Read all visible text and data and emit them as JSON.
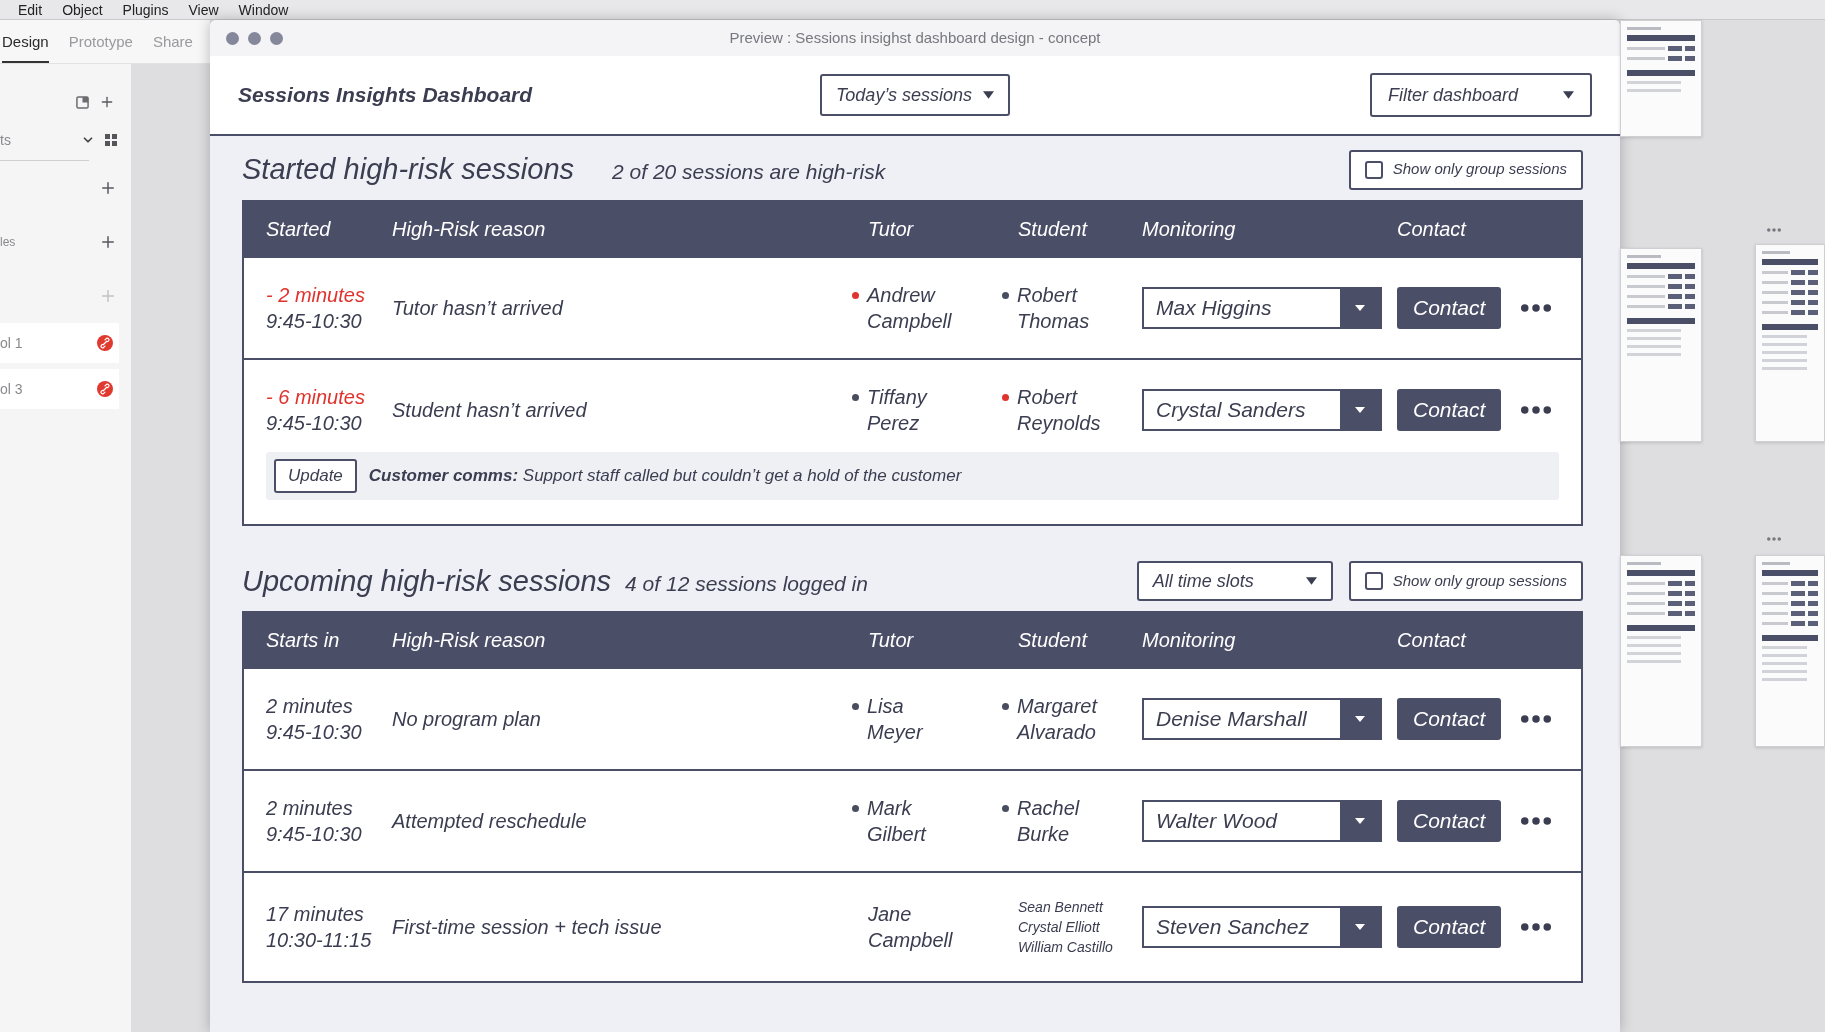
{
  "menu_bar": {
    "items": [
      "Edit",
      "Object",
      "Plugins",
      "View",
      "Window"
    ]
  },
  "side_panel": {
    "tabs": [
      {
        "label": "Design",
        "selected": true
      },
      {
        "label": "Prototype",
        "selected": false
      },
      {
        "label": "Share",
        "selected": false
      }
    ],
    "rows": [
      {
        "kind": "tools"
      },
      {
        "kind": "select",
        "label": "ts"
      },
      {
        "kind": "add",
        "disabled": false
      },
      {
        "kind": "add",
        "label": "les",
        "disabled": false
      },
      {
        "kind": "add",
        "disabled": true
      },
      {
        "kind": "component",
        "label": "ol 1"
      },
      {
        "kind": "component",
        "label": "ol 3"
      }
    ]
  },
  "preview": {
    "title": "Preview : Sessions insighst dashboard design - concept",
    "header": {
      "title": "Sessions Insights Dashboard",
      "day_select": "Today’s sessions",
      "filter_select": "Filter dashboard"
    },
    "started": {
      "title": "Started high-risk sessions",
      "summary": "2 of 20 sessions are high-risk",
      "group_filter": {
        "label": "Show only group sessions",
        "checked": false
      },
      "columns": [
        "Started",
        "High-Risk reason",
        "Tutor",
        "Student",
        "Monitoring",
        "Contact"
      ],
      "rows": [
        {
          "time": "- 2 minutes",
          "overdue": true,
          "slot": "9:45-10:30",
          "reason": "Tutor hasn’t arrived",
          "tutor": {
            "name": "Andrew Campbell",
            "color": "#e0332e"
          },
          "students": [
            {
              "name": "Robert Thomas",
              "color": "#4a4d5e"
            }
          ],
          "monitor": "Max Higgins",
          "contact": "Contact"
        },
        {
          "time": "- 6 minutes",
          "overdue": true,
          "slot": "9:45-10:30",
          "reason": "Student hasn’t arrived",
          "tutor": {
            "name": "Tiffany Perez",
            "color": "#4a4d5e"
          },
          "students": [
            {
              "name": "Robert Reynolds",
              "color": "#e0332e"
            }
          ],
          "monitor": "Crystal Sanders",
          "contact": "Contact",
          "note": {
            "button": "Update",
            "text": "**Customer comms:** Support staff called but couldn’t get a hold of the customer"
          }
        }
      ]
    },
    "upcoming": {
      "title": "Upcoming high-risk sessions",
      "summary": "4 of 12 sessions logged in",
      "slot_select": "All time slots",
      "group_filter": {
        "label": "Show only group sessions",
        "checked": false
      },
      "columns": [
        "Starts in",
        "High-Risk reason",
        "Tutor",
        "Student",
        "Monitoring",
        "Contact"
      ],
      "rows": [
        {
          "time": "2 minutes",
          "overdue": false,
          "slot": "9:45-10:30",
          "reason": "No program plan",
          "tutor": {
            "name": "Lisa Meyer",
            "color": "#4a4d5e"
          },
          "students": [
            {
              "name": "Margaret Alvarado",
              "color": "#4a4d5e"
            }
          ],
          "monitor": "Denise Marshall",
          "contact": "Contact"
        },
        {
          "time": "2 minutes",
          "overdue": false,
          "slot": "9:45-10:30",
          "reason": "Attempted reschedule",
          "tutor": {
            "name": "Mark Gilbert",
            "color": "#4a4d5e"
          },
          "students": [
            {
              "name": "Rachel Burke",
              "color": "#4a4d5e"
            }
          ],
          "monitor": "Walter Wood",
          "contact": "Contact"
        },
        {
          "time": "17 minutes",
          "overdue": false,
          "slot": "10:30-11:15",
          "reason": "First-time session + tech issue",
          "tutor": {
            "name": "Jane Campbell"
          },
          "students": [
            {
              "name": "Sean Bennett"
            },
            {
              "name": "Crystal Elliott"
            },
            {
              "name": "William Castillo"
            }
          ],
          "monitor": "Steven Sanchez",
          "contact": "Contact"
        }
      ]
    }
  }
}
